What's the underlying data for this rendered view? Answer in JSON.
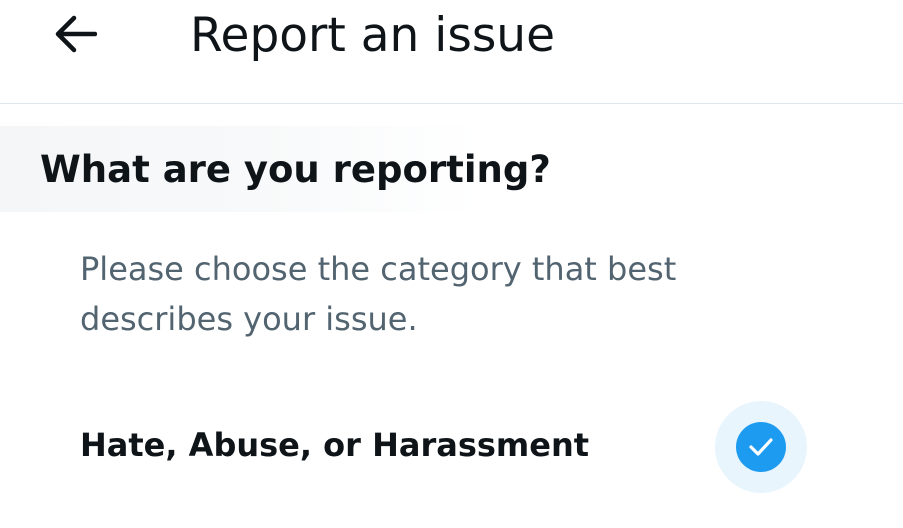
{
  "header": {
    "back_icon": "arrow-left-icon",
    "title": "Report an issue"
  },
  "section": {
    "title": "What are you reporting?",
    "description": "Please choose the category that best describes your issue."
  },
  "options": [
    {
      "label": "Hate, Abuse, or Harassment",
      "selected": true,
      "icon": "checkmark-icon"
    }
  ],
  "colors": {
    "accent": "#1d9bf0",
    "accent_halo": "#e8f5fd",
    "text_primary": "#0f1419",
    "text_secondary": "#536471",
    "divider": "#e1e8ed"
  }
}
